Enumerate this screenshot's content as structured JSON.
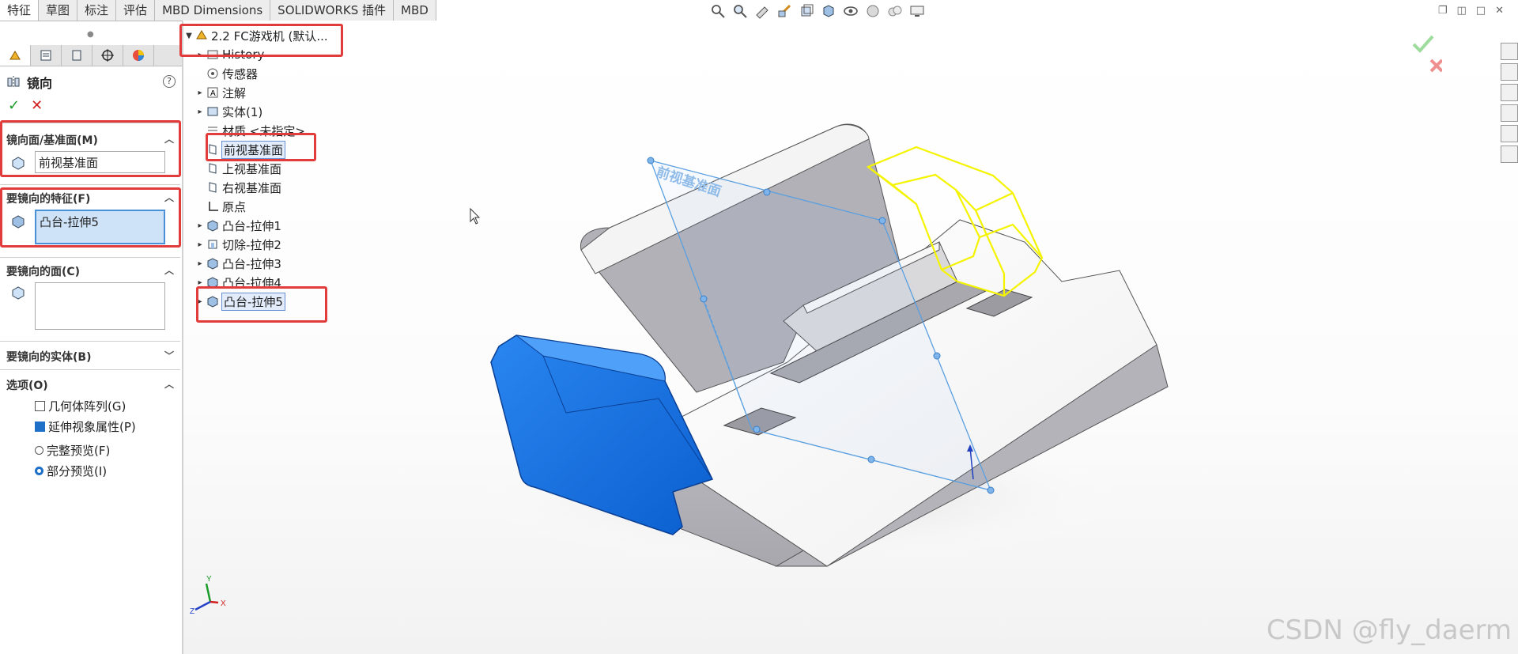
{
  "tabs": [
    "特征",
    "草图",
    "标注",
    "评估",
    "MBD Dimensions",
    "SOLIDWORKS 插件",
    "MBD"
  ],
  "property_manager": {
    "title": "镜向",
    "ok_label": "✓",
    "cancel_label": "✕",
    "mirror_plane": {
      "label": "镜向面/基准面(M)",
      "value": "前视基准面"
    },
    "features": {
      "label": "要镜向的特征(F)",
      "value": "凸台-拉伸5"
    },
    "faces": {
      "label": "要镜向的面(C)",
      "value": ""
    },
    "bodies": {
      "label": "要镜向的实体(B)"
    },
    "options": {
      "label": "选项(O)",
      "geometry_pattern": "几何体阵列(G)",
      "propagate_visual": "延伸视象属性(P)",
      "full_preview": "完整预览(F)",
      "partial_preview": "部分预览(I)",
      "geometry_pattern_checked": false,
      "propagate_visual_checked": true,
      "preview_selected": "partial"
    }
  },
  "tree": {
    "root": "2.2 FC游戏机 (默认...",
    "items": [
      "History",
      "传感器",
      "注解",
      "实体(1)",
      "材质 <未指定>",
      "前视基准面",
      "上视基准面",
      "右视基准面",
      "原点",
      "凸台-拉伸1",
      "切除-拉伸2",
      "凸台-拉伸3",
      "凸台-拉伸4",
      "凸台-拉伸5"
    ]
  },
  "viewport": {
    "plane_label": "前视基准面",
    "triad": {
      "x": "X",
      "y": "Y",
      "z": "Z"
    },
    "watermark": "CSDN @fly_daerm"
  },
  "colors": {
    "highlight_red": "#e13b3b",
    "preview_yellow": "#f4f400",
    "selected_blue": "#1466d8",
    "plane_blue": "#5a9fe0"
  }
}
